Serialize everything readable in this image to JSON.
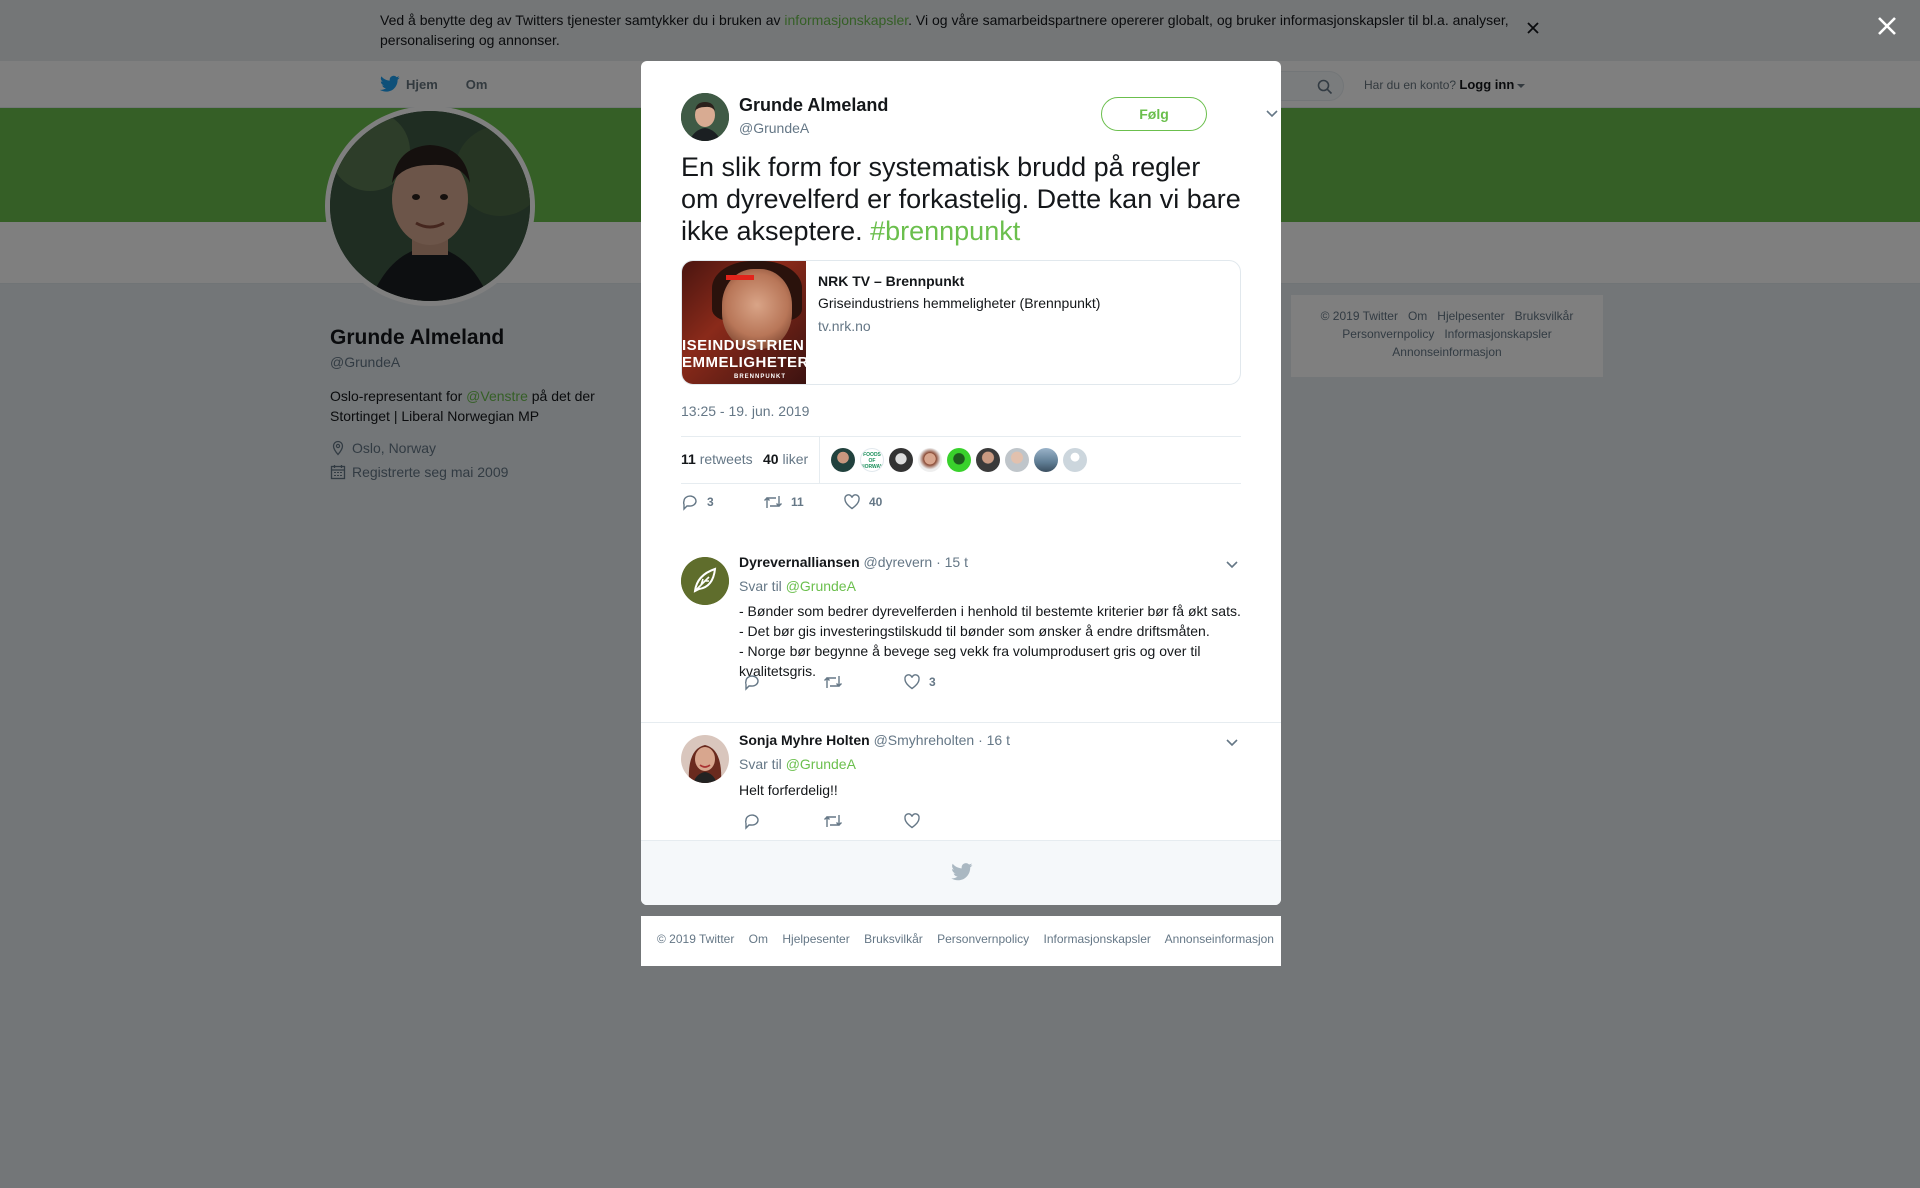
{
  "cookie": {
    "text_before": "Ved å benytte deg av Twitters tjenester samtykker du i bruken av ",
    "link": "informasjonskapsler",
    "text_after": ". Vi og våre samarbeidspartnere opererer globalt, og bruker informasjonskapsler til bl.a. analyser, personalisering og annonser."
  },
  "nav": {
    "home": "Hjem",
    "about": "Om",
    "account_prompt": "Har du en konto?",
    "login": "Logg inn"
  },
  "profile": {
    "name": "Grunde Almeland",
    "handle": "@GrundeA",
    "bio_before": "Oslo-representant for ",
    "bio_mention": "@Venstre",
    "bio_after": " på det der Stortinget | Liberal Norwegian MP",
    "location": "Oslo, Norway",
    "joined": "Registrerte seg mai 2009"
  },
  "side_footer": {
    "items": [
      "© 2019 Twitter",
      "Om",
      "Hjelpesenter",
      "Bruksvilkår",
      "Personvernpolicy",
      "Informasjonskapsler",
      "Annonseinformasjon"
    ]
  },
  "tweet": {
    "author_name": "Grunde Almeland",
    "author_handle": "@GrundeA",
    "follow_label": "Følg",
    "text": "En slik form for systematisk brudd på regler om dyrevelferd er forkastelig. Dette kan vi bare ikke akseptere. ",
    "hashtag": "#brennpunkt",
    "card": {
      "title": "NRK TV – Brennpunkt",
      "description": "Griseindustriens hemmeligheter (Brennpunkt)",
      "domain": "tv.nrk.no",
      "image_line1": "ISEINDUSTRIEN",
      "image_line2": "EMMELIGHETER",
      "image_line3": "BRENNPUNKT"
    },
    "timestamp": "13:25 - 19. jun. 2019",
    "retweets_count": "11",
    "retweets_label": "retweets",
    "likes_count": "40",
    "likes_label": "liker",
    "reply_count": "3",
    "retweet_count": "11",
    "like_count": "40"
  },
  "replies": [
    {
      "name": "Dyrevernalliansen",
      "handle": "@dyrevern",
      "time": "· 15 t",
      "reply_to_label": "Svar til",
      "reply_to": "@GrundeA",
      "lines": [
        "- Bønder som bedrer dyrevelferden i henhold til bestemte kriterier bør få økt sats.",
        "- Det bør gis investeringstilskudd til bønder som ønsker å endre driftsmåten.",
        "- Norge bør begynne å bevege seg vekk fra volumprodusert gris og over til kvalitetsgris."
      ],
      "like_count": "3"
    },
    {
      "name": "Sonja Myhre Holten",
      "handle": "@Smyhreholten",
      "time": "· 16 t",
      "reply_to_label": "Svar til",
      "reply_to": "@GrundeA",
      "lines": [
        "Helt forferdelig!!"
      ]
    }
  ],
  "modal_footer": {
    "items": [
      "© 2019 Twitter",
      "Om",
      "Hjelpesenter",
      "Bruksvilkår",
      "Personvernpolicy",
      "Informasjonskapsler",
      "Annonseinformasjon"
    ]
  },
  "colors": {
    "accent": "#6bbf4d",
    "overlay": "rgba(0,0,0,0.5)",
    "muted": "#657786"
  }
}
